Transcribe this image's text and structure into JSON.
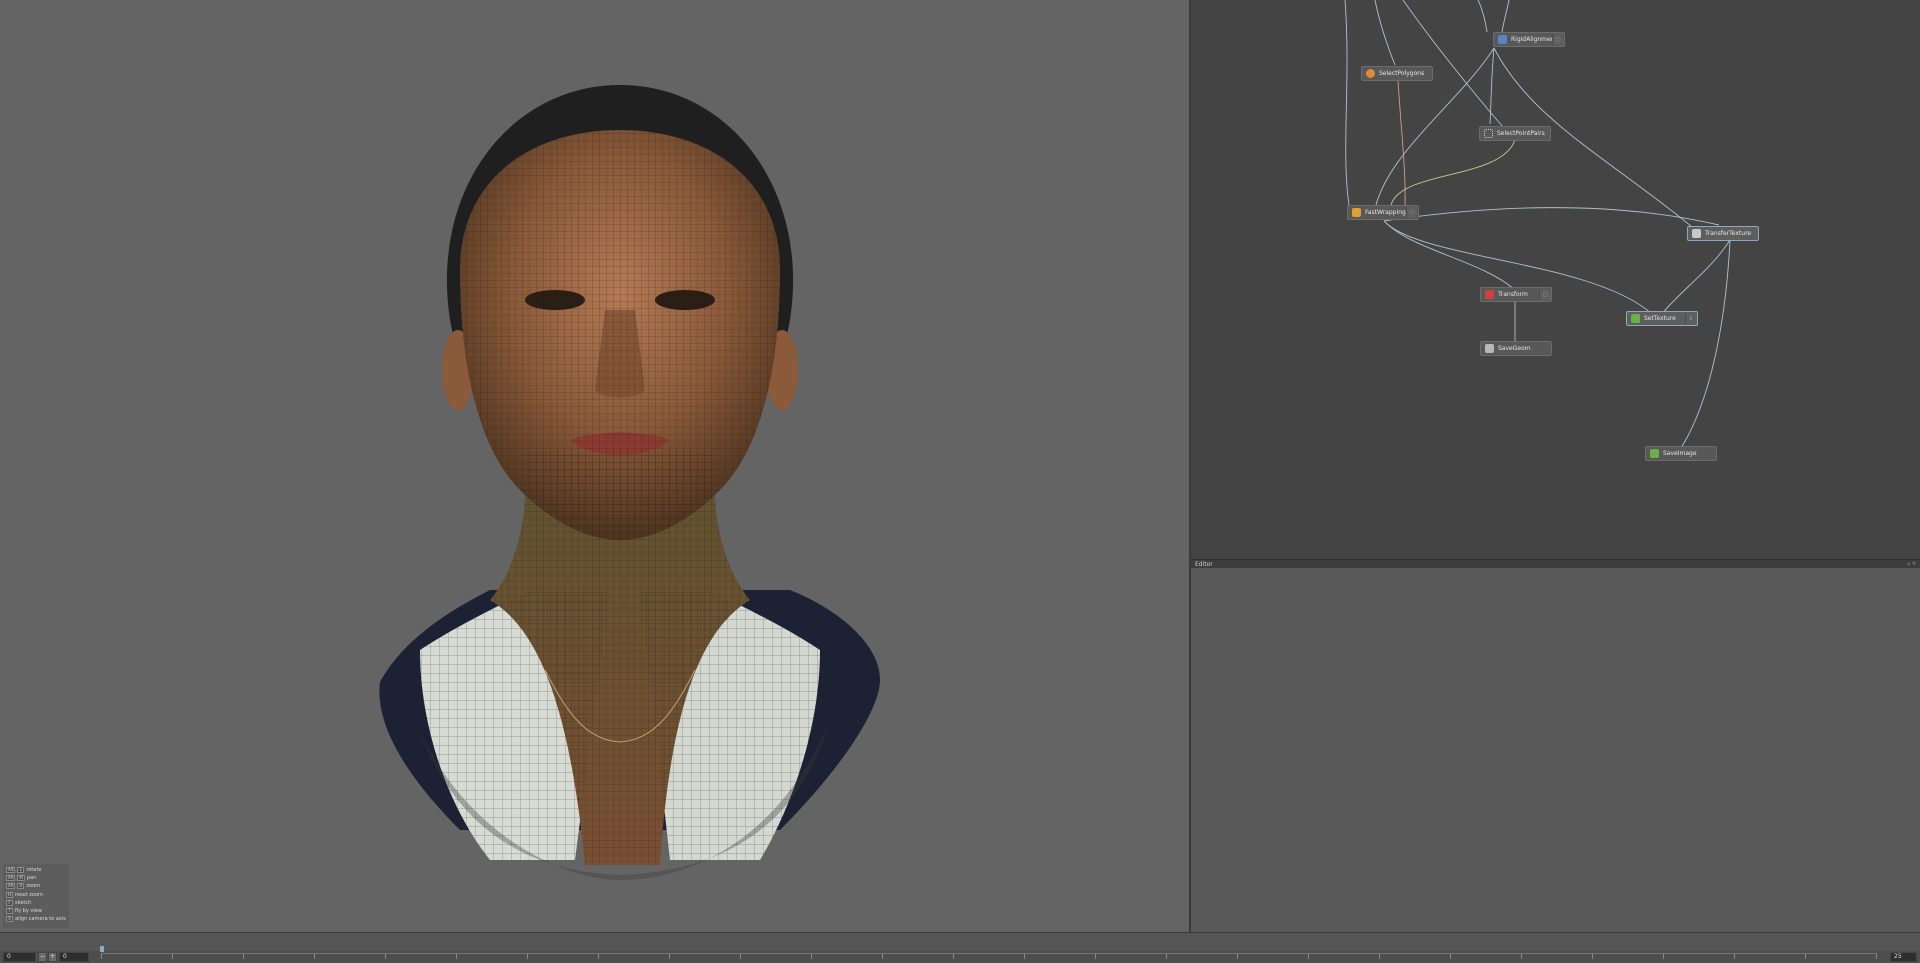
{
  "help": {
    "items": [
      {
        "keys": [
          "Alt",
          "L"
        ],
        "label": "rotate"
      },
      {
        "keys": [
          "Alt",
          "M"
        ],
        "label": "pan"
      },
      {
        "keys": [
          "Alt",
          "R"
        ],
        "label": "zoom"
      },
      {
        "keys": [
          "H"
        ],
        "label": "reset zoom"
      },
      {
        "keys": [
          "F"
        ],
        "label": "sketch"
      },
      {
        "keys": [
          "T"
        ],
        "label": "fly by view"
      },
      {
        "keys": [
          "X"
        ],
        "label": "align camera to axis"
      }
    ]
  },
  "nodes": [
    {
      "id": "rigid",
      "label": "RigidAlignment",
      "icon_color": "#5b84c4"
    },
    {
      "id": "selpoly",
      "label": "SelectPolygons",
      "icon_color": "#e08a3a"
    },
    {
      "id": "selpts",
      "label": "SelectPointPairs",
      "icon_color": "#c8c8c8"
    },
    {
      "id": "wrap",
      "label": "FastWrapping",
      "icon_color": "#e0a030"
    },
    {
      "id": "transfer",
      "label": "TransferTexture",
      "icon_color": "#c8c8c8"
    },
    {
      "id": "transform",
      "label": "Transform",
      "icon_color": "#d04040"
    },
    {
      "id": "settex",
      "label": "SetTexture",
      "icon_color": "#6ab04a"
    },
    {
      "id": "savegeom",
      "label": "SaveGeom",
      "icon_color": "#b8b8b8"
    },
    {
      "id": "saveimg",
      "label": "SaveImage",
      "icon_color": "#6ab04a"
    }
  ],
  "editor": {
    "title": "Editor",
    "controls": "▫ ×"
  },
  "timeline": {
    "start_frame": "0",
    "current_frame": "0",
    "end_frame": "25",
    "minus_label": "−",
    "plus_label": "+"
  },
  "colors": {
    "wire": "#a9c3d3",
    "wire_polygon": "#d49b9b",
    "wire_points": "#c9cc88",
    "selected_border": "#8fa8c2"
  }
}
